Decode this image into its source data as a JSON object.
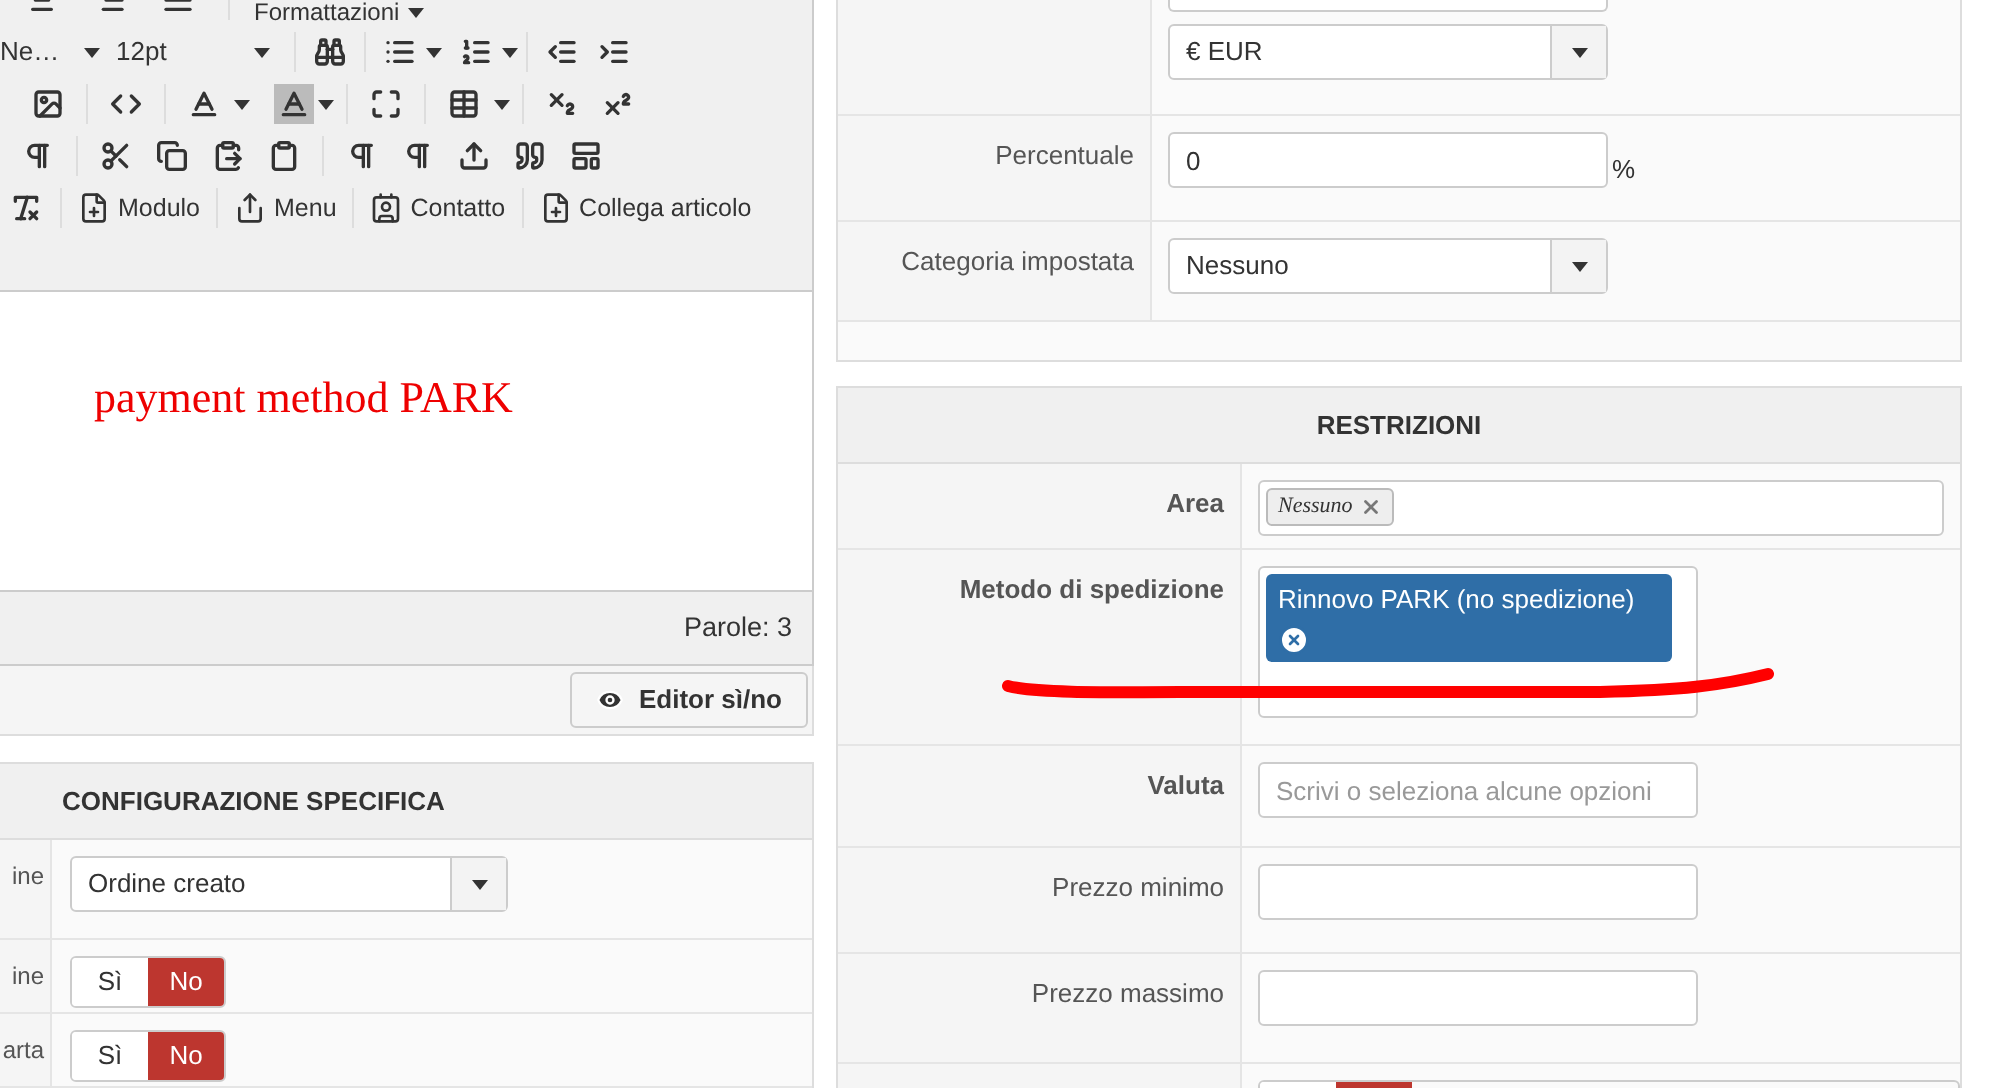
{
  "editor": {
    "format_menu": "Formattazioni",
    "font_family": "Ne…",
    "font_size": "12pt",
    "insert_buttons": [
      {
        "label": "Modulo",
        "kind": "module"
      },
      {
        "label": "Menu",
        "kind": "menu"
      },
      {
        "label": "Contatto",
        "kind": "contact"
      },
      {
        "label": "Collega articolo",
        "kind": "article"
      }
    ],
    "content": "payment method PARK",
    "word_count": "Parole: 3",
    "toggle_button": "Editor sì/no"
  },
  "config": {
    "title": "CONFIGURAZIONE SPECIFICA",
    "rows": [
      {
        "label": "ine",
        "kind": "select",
        "value": "Ordine creato"
      },
      {
        "label": "ine",
        "kind": "toggle",
        "options": [
          {
            "label": "Sì",
            "selected": false
          },
          {
            "label": "No",
            "selected": true
          }
        ]
      },
      {
        "label": "arta",
        "kind": "toggle",
        "options": [
          {
            "label": "Sì",
            "selected": false
          },
          {
            "label": "No",
            "selected": true
          }
        ]
      }
    ]
  },
  "pricing": {
    "rows": [
      {
        "kind": "select",
        "value": "€ EUR"
      },
      {
        "label": "Percentuale",
        "kind": "input",
        "value": "0",
        "suffix": "%"
      },
      {
        "label": "Categoria impostata",
        "kind": "select",
        "value": "Nessuno"
      }
    ]
  },
  "restrictions": {
    "title": "RESTRIZIONI",
    "rows": [
      {
        "label": "Area",
        "strong": true,
        "kind": "tags",
        "wide": true,
        "tags": [
          {
            "label": "Nessuno",
            "kind": "chip"
          }
        ]
      },
      {
        "label": "Metodo di spedizione",
        "strong": true,
        "kind": "tags",
        "wide": false,
        "tags": [
          {
            "label": "Rinnovo PARK (no spedizione)",
            "kind": "pill"
          }
        ]
      },
      {
        "label": "Valuta",
        "strong": true,
        "kind": "input",
        "placeholder": "Scrivi o seleziona alcune opzioni"
      },
      {
        "label": "Prezzo minimo",
        "strong": false,
        "kind": "input"
      },
      {
        "label": "Prezzo massimo",
        "strong": false,
        "kind": "input"
      },
      {
        "kind": "toggle",
        "options": [
          {
            "selected": false
          },
          {
            "selected": true
          }
        ]
      }
    ]
  }
}
